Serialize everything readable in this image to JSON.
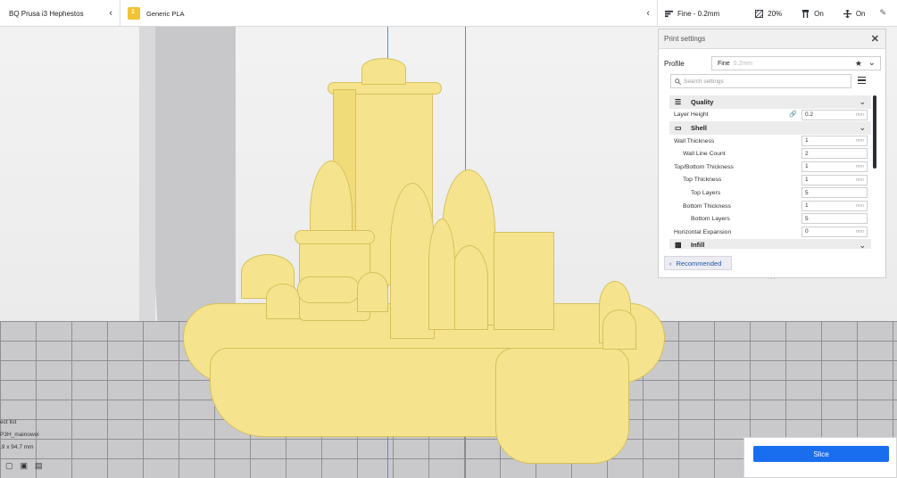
{
  "printer": {
    "name": "BQ Prusa i3 Hephestos"
  },
  "material": {
    "name": "Generic PLA"
  },
  "toolbar": {
    "profile": "Fine - 0.2mm",
    "infill": "20%",
    "support": "On",
    "adhesion": "On"
  },
  "panel": {
    "title": "Print settings",
    "profile_label": "Profile",
    "profile_value": "Fine",
    "profile_sub": "0.2mm",
    "search_placeholder": "Search settings",
    "recommended_label": "Recommended",
    "categories": {
      "quality": "Quality",
      "shell": "Shell",
      "infill": "Infill"
    },
    "settings": [
      {
        "label": "Layer Height",
        "value": "0.2",
        "unit": "mm"
      },
      {
        "label": "Wall Thickness",
        "value": "1",
        "unit": "mm"
      },
      {
        "label": "Wall Line Count",
        "value": "2",
        "unit": ""
      },
      {
        "label": "Top/Bottom Thickness",
        "value": "1",
        "unit": "mm"
      },
      {
        "label": "Top Thickness",
        "value": "1",
        "unit": "mm"
      },
      {
        "label": "Top Layers",
        "value": "5",
        "unit": ""
      },
      {
        "label": "Bottom Thickness",
        "value": "1",
        "unit": "mm"
      },
      {
        "label": "Bottom Layers",
        "value": "5",
        "unit": ""
      },
      {
        "label": "Horizontal Expansion",
        "value": "0",
        "unit": "mm"
      }
    ]
  },
  "slice": {
    "label": "Slice"
  },
  "object_list": {
    "line1": "ect list",
    "line2": "P3H_mainowoi",
    "line3": ".9 x 94.7 mm"
  },
  "colors": {
    "accent": "#196ef0",
    "model": "#f5e48d",
    "material_badge": "#f2c333"
  }
}
